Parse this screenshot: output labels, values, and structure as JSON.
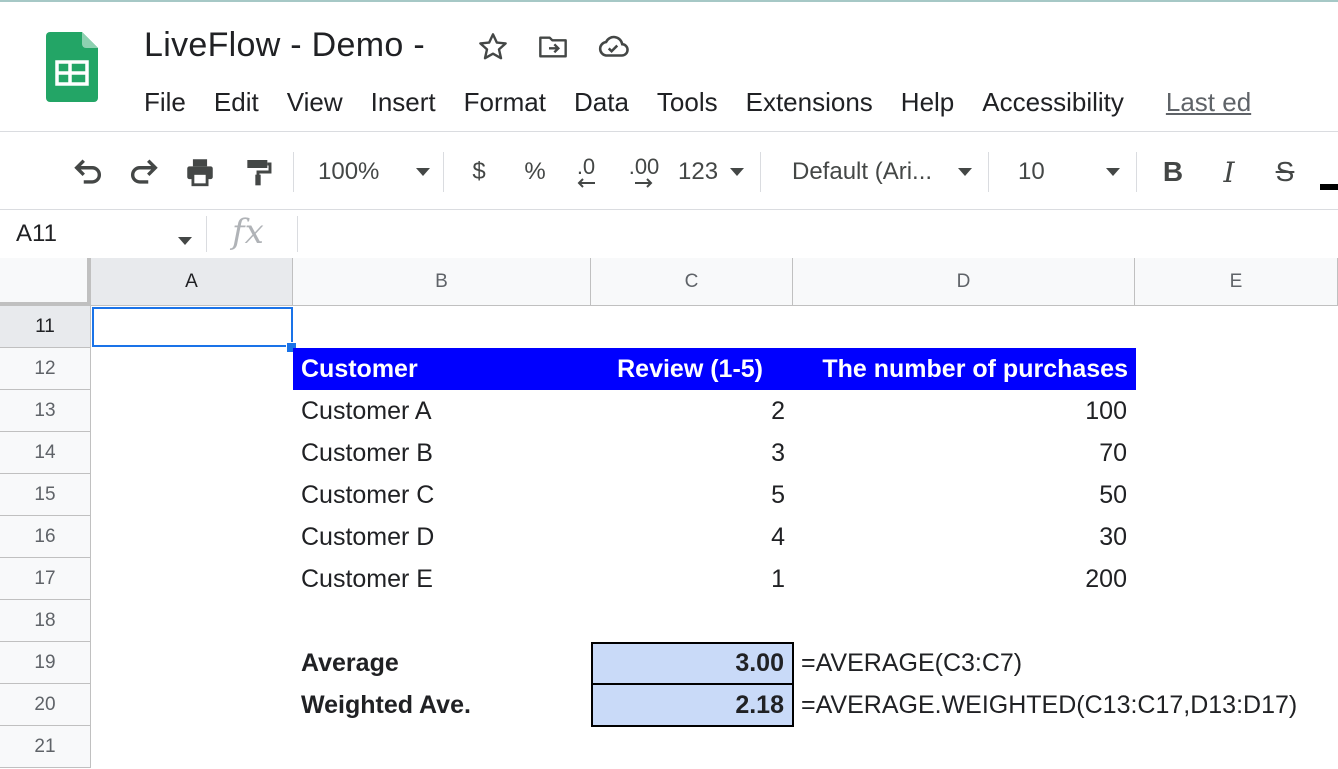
{
  "document": {
    "title": "LiveFlow - Demo -"
  },
  "title_icons": [
    "star-icon",
    "move-to-folder-icon",
    "cloud-saved-icon"
  ],
  "menu": {
    "items": [
      "File",
      "Edit",
      "View",
      "Insert",
      "Format",
      "Data",
      "Tools",
      "Extensions",
      "Help",
      "Accessibility"
    ],
    "last_edit": "Last ed"
  },
  "toolbar": {
    "zoom": "100%",
    "currency": "$",
    "percent": "%",
    "decrease_decimal": ".0",
    "increase_decimal": ".00",
    "more_formats": "123",
    "font": "Default (Ari...",
    "font_size": "10",
    "bold": "B",
    "italic": "I",
    "strikethrough": "S"
  },
  "formula_bar": {
    "name_box": "A11",
    "fx_label": "fx",
    "content": ""
  },
  "grid": {
    "columns": [
      "A",
      "B",
      "C",
      "D",
      "E"
    ],
    "rows": [
      "11",
      "12",
      "13",
      "14",
      "15",
      "16",
      "17",
      "18",
      "19",
      "20",
      "21"
    ],
    "selected_cell": "A11",
    "table": {
      "headers": [
        "Customer",
        "Review (1-5)",
        "The number of purchases"
      ],
      "rows": [
        {
          "customer": "Customer A",
          "review": "2",
          "purchases": "100"
        },
        {
          "customer": "Customer B",
          "review": "3",
          "purchases": "70"
        },
        {
          "customer": "Customer C",
          "review": "5",
          "purchases": "50"
        },
        {
          "customer": "Customer D",
          "review": "4",
          "purchases": "30"
        },
        {
          "customer": "Customer E",
          "review": "1",
          "purchases": "200"
        }
      ]
    },
    "summary": {
      "average_label": "Average",
      "average_value": "3.00",
      "average_formula": "=AVERAGE(C3:C7)",
      "weighted_label": "Weighted Ave.",
      "weighted_value": "2.18",
      "weighted_formula": "=AVERAGE.WEIGHTED(C13:C17,D13:D17)"
    }
  },
  "colors": {
    "header_fill": "#0000ff",
    "header_text": "#ffffff",
    "result_fill": "#c9daf8",
    "selection": "#1a73e8",
    "sheets_green": "#23a566"
  }
}
